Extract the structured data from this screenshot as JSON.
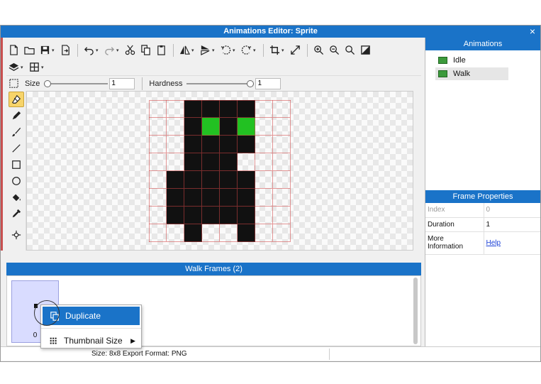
{
  "window": {
    "title": "Animations Editor: Sprite",
    "close_glyph": "×"
  },
  "options": {
    "size_label": "Size",
    "size_value": "1",
    "size_level": 0.0,
    "hardness_label": "Hardness",
    "hardness_value": "1",
    "hardness_level": 1.0
  },
  "sprite": {
    "cols": 8,
    "rows": 8,
    "pixels": [
      "..GGGG..",
      "..GEGE..",
      "..GGGG..",
      "..GGG...",
      ".GGGGG..",
      ".GGGGG..",
      ".GGGGG..",
      "..G..G.."
    ],
    "colors": {
      "G": "#111111",
      "E": "#22c122"
    }
  },
  "frames": {
    "header": "Walk Frames (2)",
    "items": [
      {
        "index": "0"
      }
    ]
  },
  "context_menu": {
    "duplicate": "Duplicate",
    "thumbnail_size": "Thumbnail Size"
  },
  "status": {
    "text": "Size: 8x8  Export Format: PNG"
  },
  "animations": {
    "header": "Animations",
    "items": [
      {
        "name": "Idle"
      },
      {
        "name": "Walk"
      }
    ]
  },
  "frame_properties": {
    "header": "Frame Properties",
    "index_label": "Index",
    "index_value": "0",
    "duration_label": "Duration",
    "duration_value": "1",
    "more_label": "More Information",
    "help_link": "Help"
  },
  "colors": {
    "accent": "#1a73c8",
    "active_tool": "#f7d46a"
  }
}
